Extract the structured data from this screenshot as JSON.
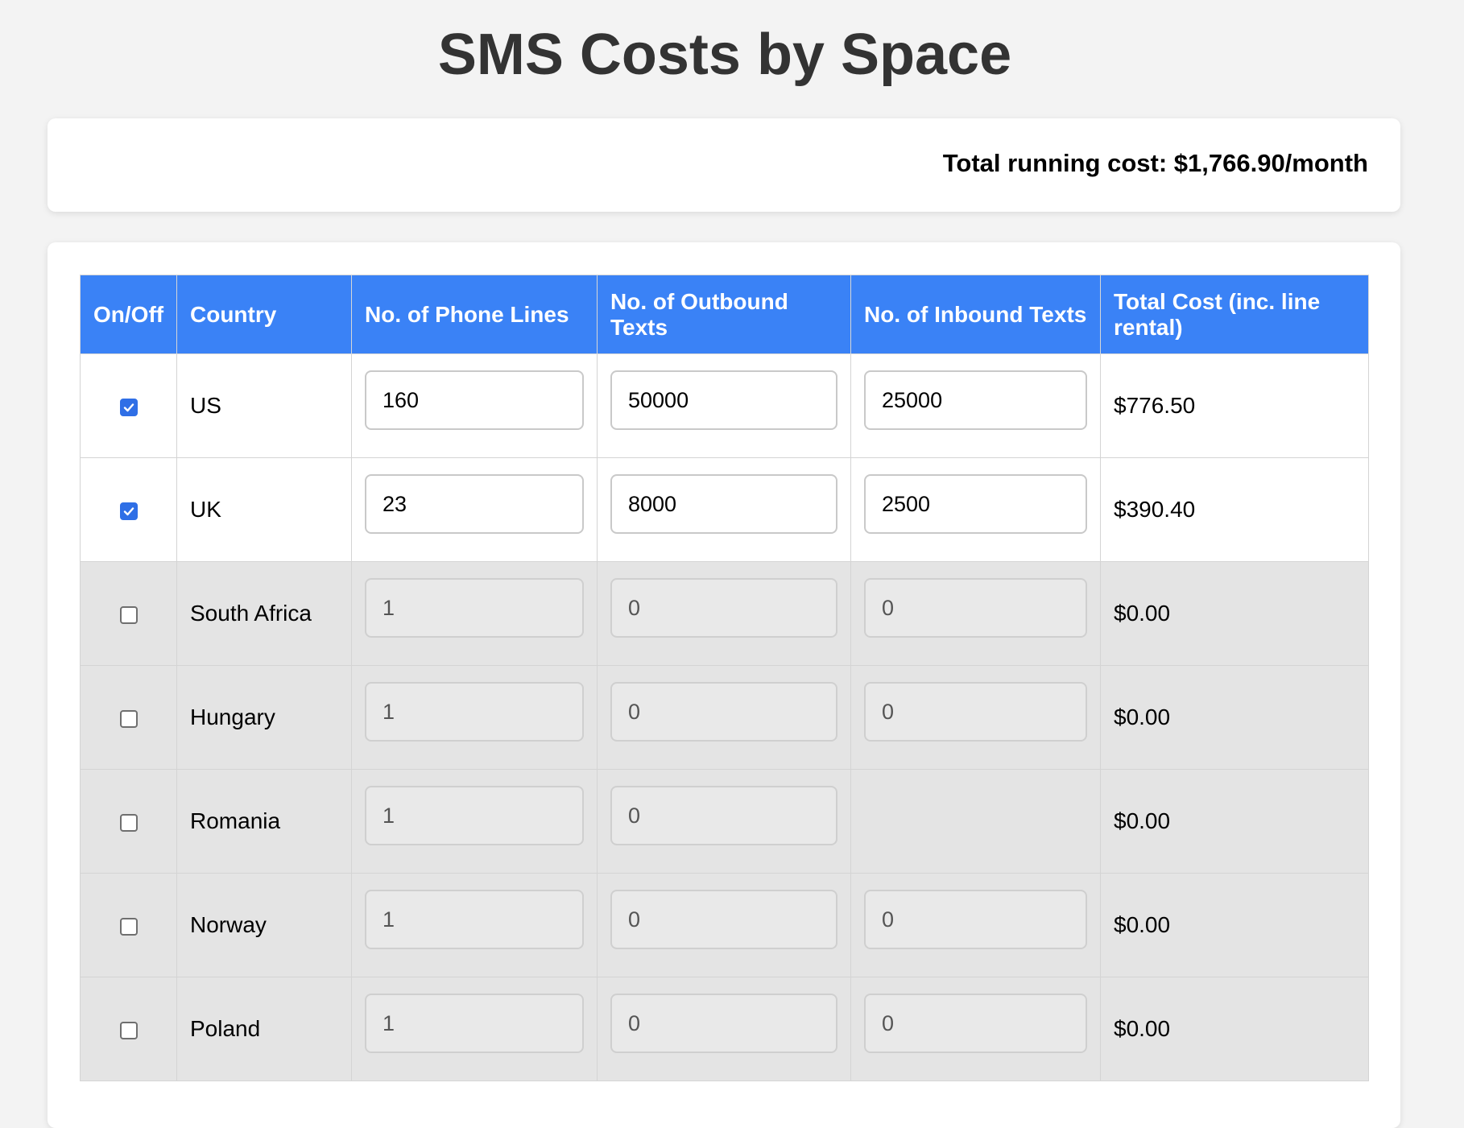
{
  "title": "SMS Costs by Space",
  "summary": {
    "total_label": "Total running cost: $1,766.90/month"
  },
  "colors": {
    "header_bg": "#3a82f6",
    "checkbox_on": "#2f6fe6",
    "disabled_row_bg": "#e4e4e4",
    "page_bg": "#f3f3f3"
  },
  "table": {
    "headers": [
      "On/Off",
      "Country",
      "No. of Phone Lines",
      "No. of Outbound Texts",
      "No. of Inbound Texts",
      "Total Cost (inc. line rental)"
    ],
    "rows": [
      {
        "enabled": true,
        "country": "US",
        "lines": "160",
        "outbound": "50000",
        "inbound": "25000",
        "cost": "$776.50"
      },
      {
        "enabled": true,
        "country": "UK",
        "lines": "23",
        "outbound": "8000",
        "inbound": "2500",
        "cost": "$390.40"
      },
      {
        "enabled": false,
        "country": "South Africa",
        "lines": "1",
        "outbound": "0",
        "inbound": "0",
        "cost": "$0.00"
      },
      {
        "enabled": false,
        "country": "Hungary",
        "lines": "1",
        "outbound": "0",
        "inbound": "0",
        "cost": "$0.00"
      },
      {
        "enabled": false,
        "country": "Romania",
        "lines": "1",
        "outbound": "0",
        "inbound": null,
        "cost": "$0.00"
      },
      {
        "enabled": false,
        "country": "Norway",
        "lines": "1",
        "outbound": "0",
        "inbound": "0",
        "cost": "$0.00"
      },
      {
        "enabled": false,
        "country": "Poland",
        "lines": "1",
        "outbound": "0",
        "inbound": "0",
        "cost": "$0.00"
      }
    ]
  }
}
